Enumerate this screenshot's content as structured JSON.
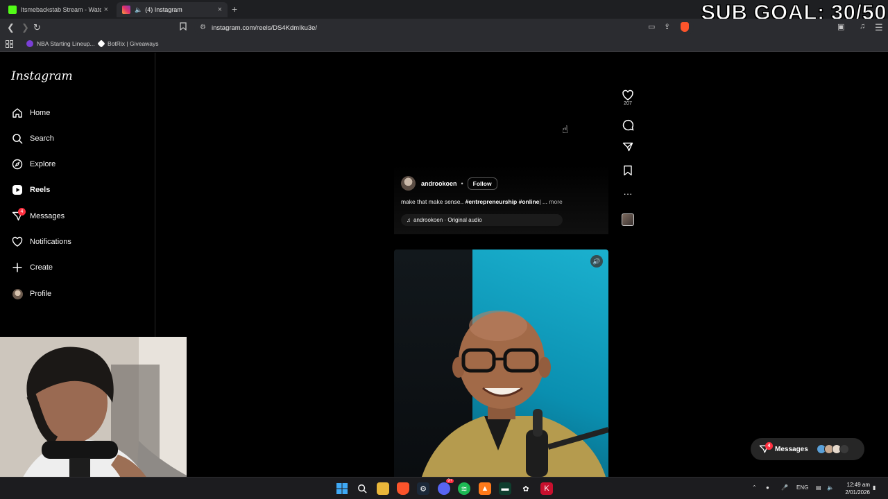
{
  "overlay": {
    "sub_goal": "SUB GOAL: 30/50"
  },
  "tabs": [
    {
      "title": "Itsmebackstab Stream - Watch Live o",
      "favicon_color": "#53fc18"
    },
    {
      "title": "(4) Instagram",
      "favicon_color": "#e1306c"
    }
  ],
  "browser": {
    "url": "instagram.com/reels/DS4KdmIku3e/"
  },
  "bookmarks": [
    {
      "label": "NBA Starting Lineup...",
      "color": "#7a3fd6"
    },
    {
      "label": "BotRix | Giveaways",
      "color": "#ffffff"
    }
  ],
  "sidebar": {
    "logo": "Instagram",
    "items": [
      {
        "label": "Home",
        "icon": "home-icon"
      },
      {
        "label": "Search",
        "icon": "search-icon"
      },
      {
        "label": "Explore",
        "icon": "compass-icon"
      },
      {
        "label": "Reels",
        "icon": "reels-icon"
      },
      {
        "label": "Messages",
        "icon": "messages-icon",
        "badge": "4"
      },
      {
        "label": "Notifications",
        "icon": "heart-icon"
      },
      {
        "label": "Create",
        "icon": "plus-icon"
      },
      {
        "label": "Profile",
        "icon": "avatar"
      }
    ]
  },
  "reel": {
    "username": "androokoen",
    "separator": "•",
    "follow_label": "Follow",
    "caption_plain": "make that make sense.. ",
    "caption_tags": "#entrepreneurship #online",
    "caption_trunc": "| ... ",
    "caption_more": "more",
    "audio": "androokoen · Original audio",
    "likes": "207"
  },
  "messages_pill": {
    "label": "Messages",
    "badge": "4"
  },
  "taskbar": {
    "lang": "ENG",
    "time": "12:49 am",
    "date": "2/01/2026",
    "notif_badge": "9+"
  },
  "colors": {
    "accent_red": "#ff3040",
    "bg": "#000000",
    "reel_blue": "#1bb1cf"
  }
}
